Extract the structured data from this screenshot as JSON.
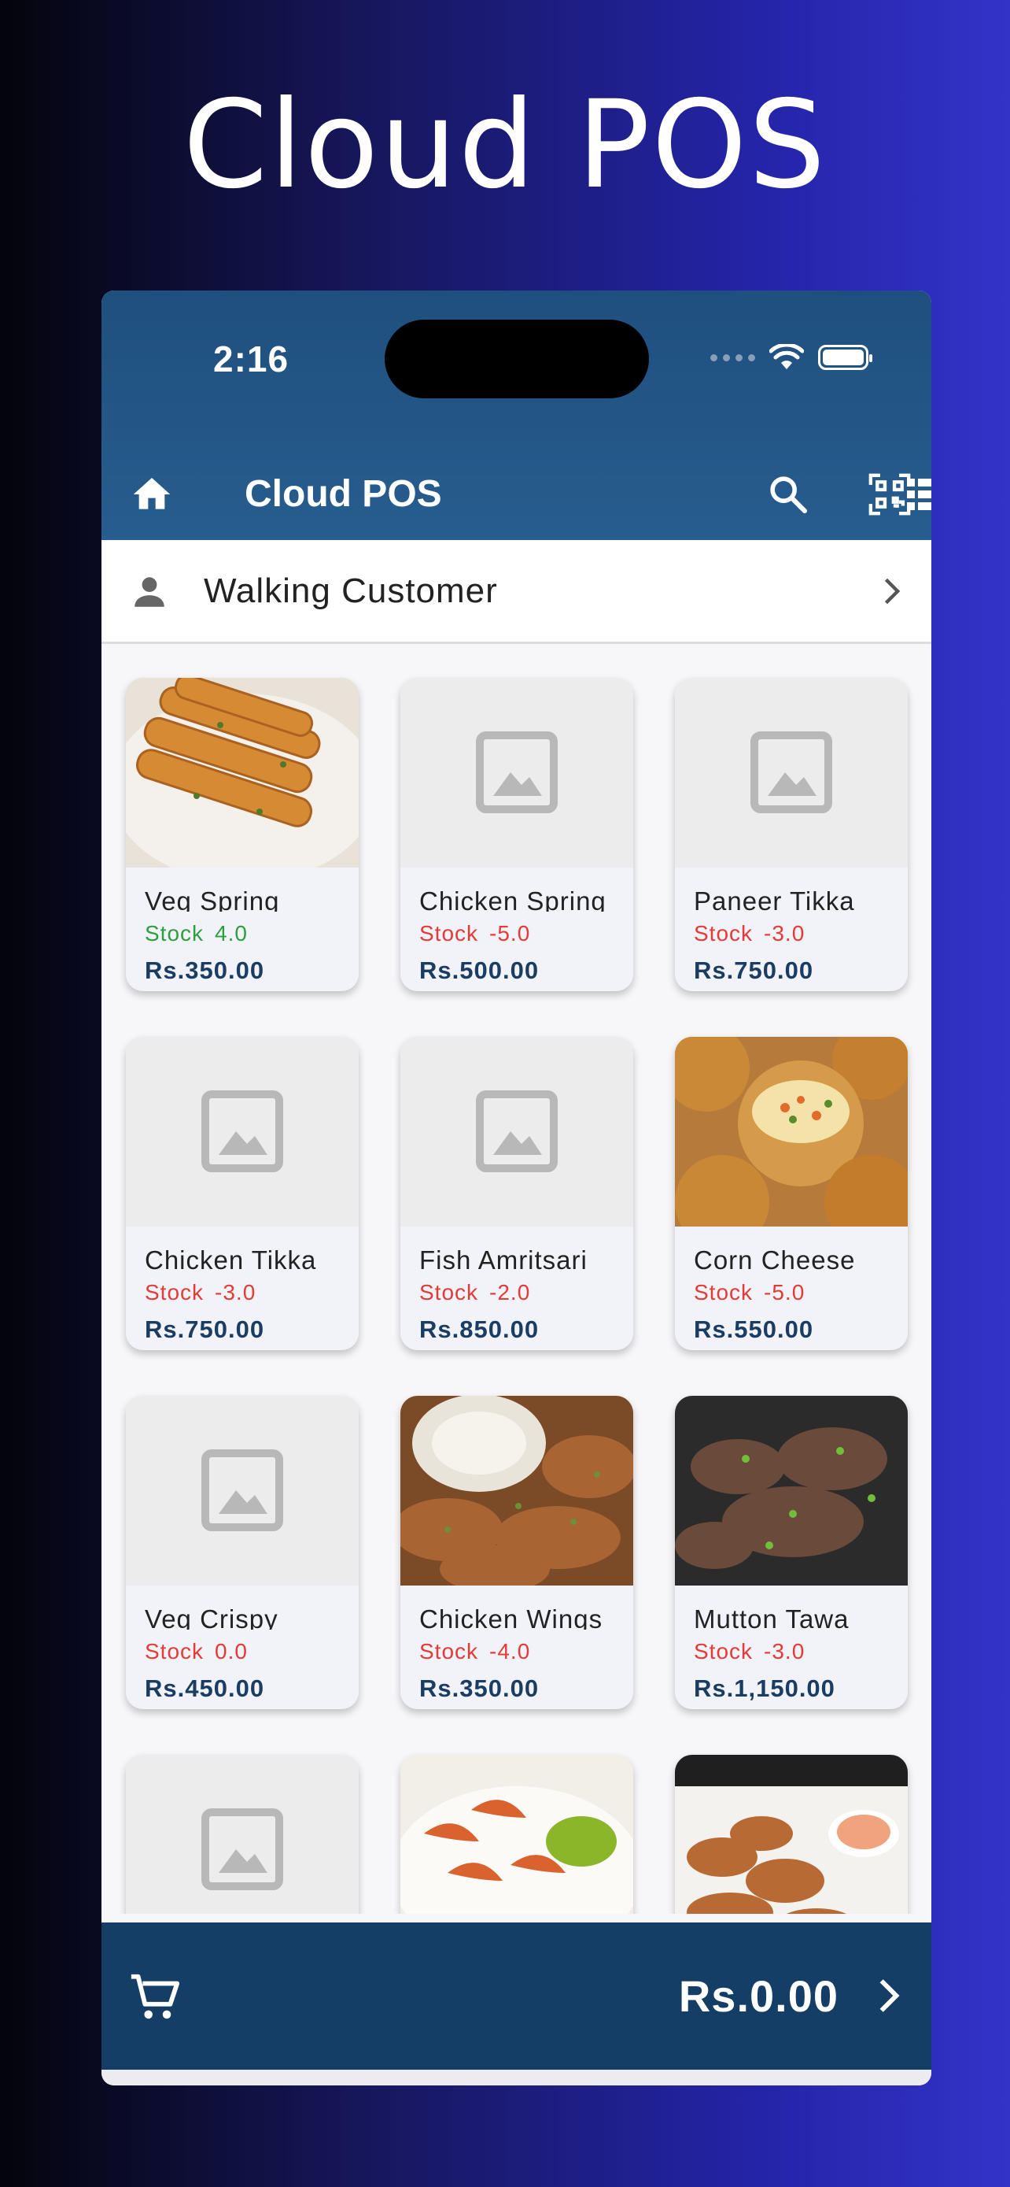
{
  "promo": {
    "title": "Cloud POS"
  },
  "status_bar": {
    "time": "2:16"
  },
  "app_bar": {
    "title": "Cloud POS",
    "icons": [
      "home-icon",
      "search-icon",
      "qr-scan-icon",
      "list-view-icon"
    ]
  },
  "customer": {
    "name": "Walking Customer"
  },
  "stock_label": "Stock",
  "products": [
    {
      "name": "Veg Spring",
      "stock": "4.0",
      "price": "Rs.350.00",
      "image": "spring-rolls-photo",
      "stock_status": "positive"
    },
    {
      "name": "Chicken Spring",
      "stock": "-5.0",
      "price": "Rs.500.00",
      "image": "placeholder",
      "stock_status": "negative"
    },
    {
      "name": "Paneer Tikka",
      "stock": "-3.0",
      "price": "Rs.750.00",
      "image": "placeholder",
      "stock_status": "negative"
    },
    {
      "name": "Chicken Tikka",
      "stock": "-3.0",
      "price": "Rs.750.00",
      "image": "placeholder",
      "stock_status": "negative"
    },
    {
      "name": "Fish Amritsari",
      "stock": "-2.0",
      "price": "Rs.850.00",
      "image": "placeholder",
      "stock_status": "negative"
    },
    {
      "name": "Corn Cheese",
      "stock": "-5.0",
      "price": "Rs.550.00",
      "image": "corn-cheese-balls-photo",
      "stock_status": "negative"
    },
    {
      "name": "Veg Crispy",
      "stock": "0.0",
      "price": "Rs.450.00",
      "image": "placeholder",
      "stock_status": "negative"
    },
    {
      "name": "Chicken Wings",
      "stock": "-4.0",
      "price": "Rs.350.00",
      "image": "chicken-wings-photo",
      "stock_status": "negative"
    },
    {
      "name": "Mutton Tawa",
      "stock": "-3.0",
      "price": "Rs.1,150.00",
      "image": "mutton-tawa-photo",
      "stock_status": "negative"
    },
    {
      "name": "",
      "stock": "",
      "price": "",
      "image": "placeholder",
      "stock_status": ""
    },
    {
      "name": "",
      "stock": "",
      "price": "",
      "image": "prawns-photo",
      "stock_status": ""
    },
    {
      "name": "",
      "stock": "",
      "price": "",
      "image": "fried-prawns-photo",
      "stock_status": ""
    }
  ],
  "cart": {
    "total": "Rs.0.00"
  },
  "colors": {
    "header": "#275d8f",
    "cart_bar": "#143e66",
    "price_text": "#1c3d63",
    "stock_positive": "#2e9e3e",
    "stock_negative": "#e53a35"
  }
}
